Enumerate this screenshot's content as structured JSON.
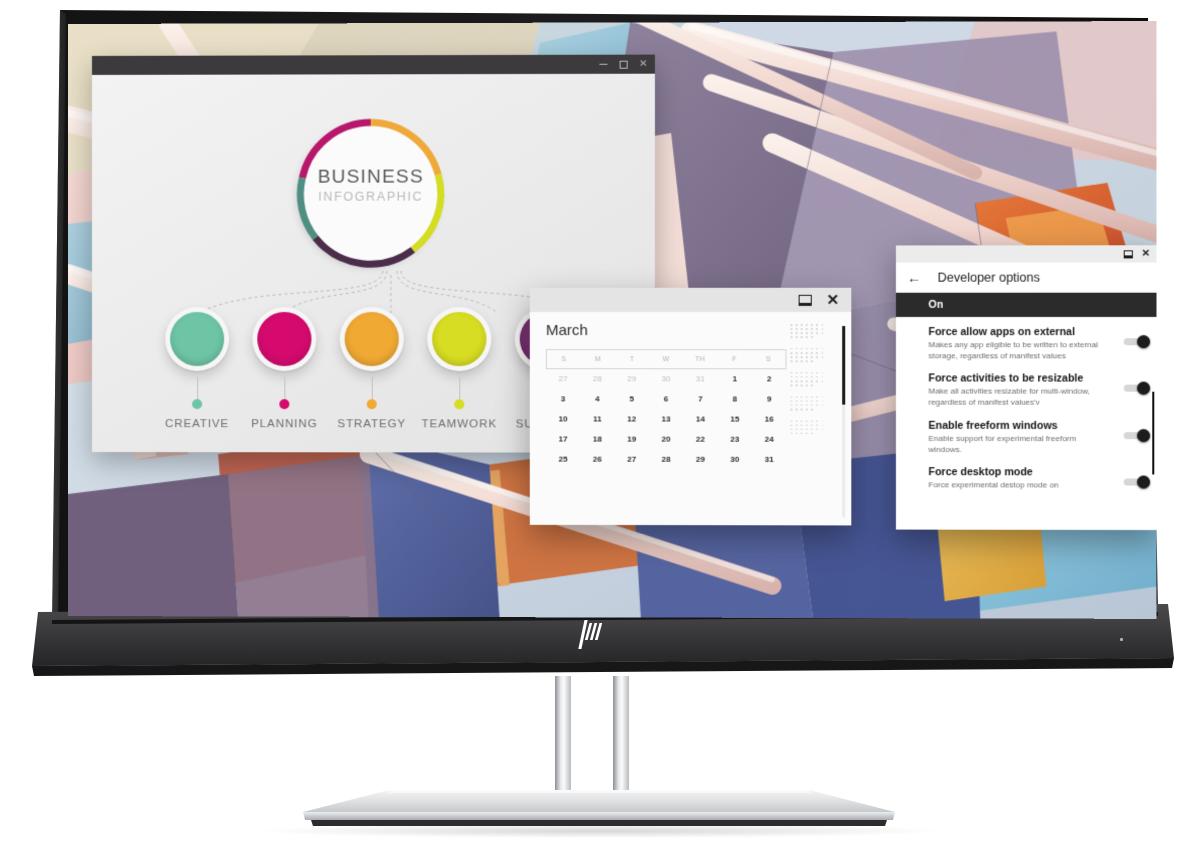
{
  "product": {
    "brand_logo": "hp-logo",
    "monitor_type": "desktop-monitor"
  },
  "desktop": {
    "wallpaper_name": "abstract-architecture-wallpaper"
  },
  "infographic_window": {
    "titlebar": {
      "minimize_label": "minimize-icon",
      "maximize_label": "maximize-icon",
      "close_label": "close-icon"
    },
    "center": {
      "title": "BUSINESS",
      "subtitle": "INFOGRAPHIC"
    },
    "ring_colors": [
      "#b8186b",
      "#efa93a",
      "#d4dc23",
      "#4b2c49",
      "#4f8f82"
    ],
    "nodes": [
      {
        "label": "CREATIVE",
        "color": "#6ec5a6"
      },
      {
        "label": "PLANNING",
        "color": "#d60a6e"
      },
      {
        "label": "STRATEGY",
        "color": "#f0a933"
      },
      {
        "label": "TEAMWORK",
        "color": "#d7dd22"
      },
      {
        "label": "SUCCESS",
        "color": "#7c3173"
      }
    ]
  },
  "calendar_window": {
    "titlebar": {
      "restore_label": "restore-window-icon",
      "close_label": "close-icon"
    },
    "month": "March",
    "weekdays": [
      "S",
      "M",
      "T",
      "W",
      "TH",
      "F",
      "S"
    ],
    "weeks": [
      [
        {
          "d": "27",
          "muted": true
        },
        {
          "d": "28",
          "muted": true
        },
        {
          "d": "29",
          "muted": true
        },
        {
          "d": "30",
          "muted": true
        },
        {
          "d": "31",
          "muted": true
        },
        {
          "d": "1",
          "muted": false
        },
        {
          "d": "2",
          "muted": false
        }
      ],
      [
        {
          "d": "3",
          "muted": false
        },
        {
          "d": "4",
          "muted": false
        },
        {
          "d": "5",
          "muted": false
        },
        {
          "d": "6",
          "muted": false
        },
        {
          "d": "7",
          "muted": false
        },
        {
          "d": "8",
          "muted": false
        },
        {
          "d": "9",
          "muted": false
        }
      ],
      [
        {
          "d": "10",
          "muted": false
        },
        {
          "d": "11",
          "muted": false
        },
        {
          "d": "12",
          "muted": false
        },
        {
          "d": "13",
          "muted": false
        },
        {
          "d": "14",
          "muted": false
        },
        {
          "d": "15",
          "muted": false
        },
        {
          "d": "16",
          "muted": false
        }
      ],
      [
        {
          "d": "17",
          "muted": false
        },
        {
          "d": "18",
          "muted": false
        },
        {
          "d": "19",
          "muted": false
        },
        {
          "d": "20",
          "muted": false
        },
        {
          "d": "22",
          "muted": false
        },
        {
          "d": "23",
          "muted": false
        },
        {
          "d": "24",
          "muted": false
        }
      ],
      [
        {
          "d": "25",
          "muted": false
        },
        {
          "d": "26",
          "muted": false
        },
        {
          "d": "27",
          "muted": false
        },
        {
          "d": "28",
          "muted": false
        },
        {
          "d": "29",
          "muted": false
        },
        {
          "d": "30",
          "muted": false
        },
        {
          "d": "31",
          "muted": false
        }
      ]
    ]
  },
  "developer_options_window": {
    "titlebar": {
      "restore_label": "restore-window-icon",
      "close_label": "close-icon"
    },
    "back_label": "back-arrow-icon",
    "title": "Developer options",
    "master_state": "On",
    "items": [
      {
        "title": "Force allow apps on external",
        "description": "Makes any app eligible to be written to external storage, regardless of manifest values",
        "enabled": true
      },
      {
        "title": "Force activities to be resizable",
        "description": "Make all activities resizable for multi-window, regardless of manifest values'v",
        "enabled": true
      },
      {
        "title": "Enable freeform windows",
        "description": "Enable support for experimental freeform windows.",
        "enabled": true
      },
      {
        "title": "Force desktop mode",
        "description": "Force experimental destop mode on",
        "enabled": true
      }
    ]
  }
}
